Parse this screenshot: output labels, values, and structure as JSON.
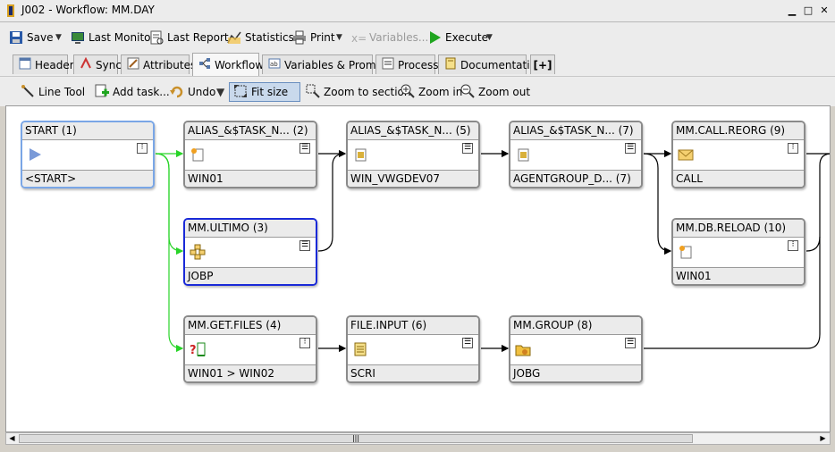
{
  "window": {
    "title": "J002 - Workflow: MM.DAY"
  },
  "toolbar": {
    "save": "Save",
    "last_monitor": "Last Monitor",
    "last_report": "Last Report",
    "statistics": "Statistics",
    "print": "Print",
    "variables": "Variables...",
    "execute": "Execute"
  },
  "tabs": [
    {
      "label": "Header"
    },
    {
      "label": "Sync"
    },
    {
      "label": "Attributes"
    },
    {
      "label": "Workflow"
    },
    {
      "label": "Variables & Prompts"
    },
    {
      "label": "Process"
    },
    {
      "label": "Documentation"
    },
    {
      "label": "[+]"
    }
  ],
  "workflow_toolbar": {
    "line_tool": "Line Tool",
    "add_task": "Add task...",
    "undo": "Undo",
    "fit_size": "Fit size",
    "zoom_to_section": "Zoom to section",
    "zoom_in": "Zoom in",
    "zoom_out": "Zoom out"
  },
  "nodes": [
    {
      "title": "START (1)",
      "footer": "<START>",
      "icon": "play-icon"
    },
    {
      "title": "ALIAS_&$TASK_N... (2)",
      "footer": "WIN01",
      "icon": "job-icon"
    },
    {
      "title": "MM.ULTIMO (3)",
      "footer": "JOBP",
      "icon": "workflow-icon"
    },
    {
      "title": "MM.GET.FILES (4)",
      "footer": "WIN01 > WIN02",
      "icon": "file-transfer-icon"
    },
    {
      "title": "ALIAS_&$TASK_N... (5)",
      "footer": "WIN_VWGDEV07",
      "icon": "job-icon"
    },
    {
      "title": "FILE.INPUT (6)",
      "footer": "SCRI",
      "icon": "script-icon"
    },
    {
      "title": "ALIAS_&$TASK_N... (7)",
      "footer": "AGENTGROUP_D... (7)",
      "icon": "job-icon"
    },
    {
      "title": "MM.GROUP (8)",
      "footer": "JOBG",
      "icon": "group-icon"
    },
    {
      "title": "MM.CALL.REORG (9)",
      "footer": "CALL",
      "icon": "envelope-icon"
    },
    {
      "title": "MM.DB.RELOAD (10)",
      "footer": "WIN01",
      "icon": "job-icon"
    }
  ],
  "colors": {
    "accent": "#f5a623",
    "selected_light": "#7aa6e6",
    "selected_dark": "#1a2ad8",
    "green_line": "#28d428"
  },
  "scrollbar": {
    "grip": "|||"
  }
}
